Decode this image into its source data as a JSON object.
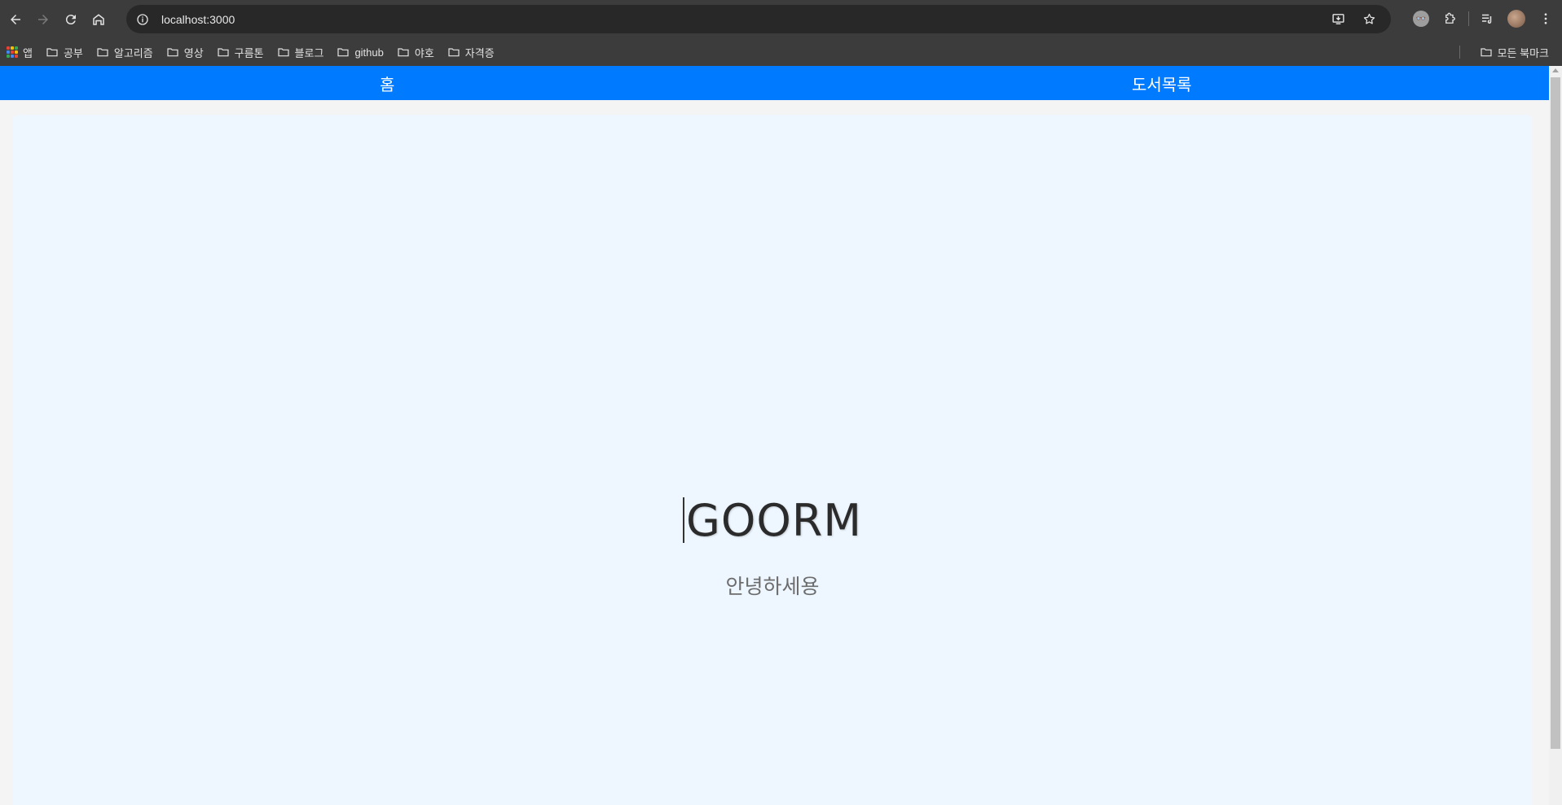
{
  "browser": {
    "url": "localhost:3000",
    "bookmarks": [
      {
        "label": "앱",
        "icon": "apps-grid-icon"
      },
      {
        "label": "공부",
        "icon": "folder-icon"
      },
      {
        "label": "알고리즘",
        "icon": "folder-icon"
      },
      {
        "label": "영상",
        "icon": "folder-icon"
      },
      {
        "label": "구름톤",
        "icon": "folder-icon"
      },
      {
        "label": "블로그",
        "icon": "folder-icon"
      },
      {
        "label": "github",
        "icon": "folder-icon"
      },
      {
        "label": "야호",
        "icon": "folder-icon"
      },
      {
        "label": "자격증",
        "icon": "folder-icon"
      }
    ],
    "all_bookmarks_label": "모든 북마크"
  },
  "page": {
    "nav": {
      "home_label": "홈",
      "books_label": "도서목록"
    },
    "hero": {
      "title": "GOORM",
      "subtitle": "안녕하세용"
    }
  },
  "colors": {
    "nav_bg": "#007bff",
    "hero_bg": "#eef7ff",
    "chrome_bg": "#3c3c3c"
  }
}
